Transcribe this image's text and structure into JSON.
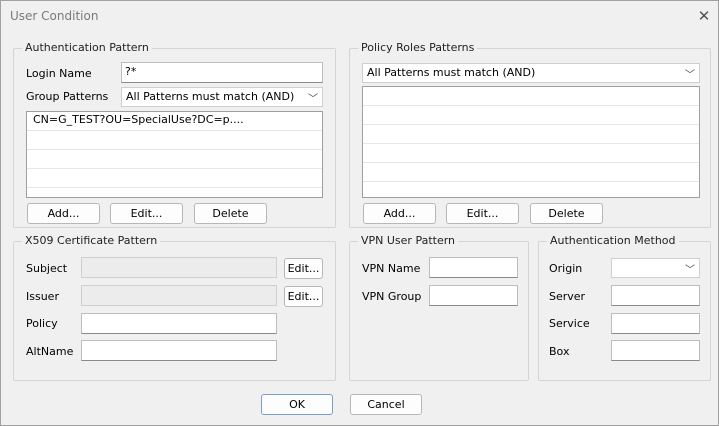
{
  "window": {
    "title": "User Condition"
  },
  "auth_pattern": {
    "legend": "Authentication Pattern",
    "login_label": "Login Name",
    "login_value": "?*",
    "group_label": "Group Patterns",
    "group_select": "All Patterns must match (AND)",
    "items": [
      "CN=G_TEST?OU=SpecialUse?DC=p....",
      "",
      "",
      "",
      ""
    ],
    "add": "Add...",
    "edit": "Edit...",
    "delete": "Delete"
  },
  "policy_roles": {
    "legend": "Policy Roles Patterns",
    "select": "All Patterns must match (AND)",
    "items": [
      "",
      "",
      "",
      "",
      "",
      ""
    ],
    "add": "Add...",
    "edit": "Edit...",
    "delete": "Delete"
  },
  "x509": {
    "legend": "X509 Certificate Pattern",
    "subject_label": "Subject",
    "issuer_label": "Issuer",
    "policy_label": "Policy",
    "altname_label": "AltName",
    "subject_edit": "Edit...",
    "issuer_edit": "Edit..."
  },
  "vpn_user": {
    "legend": "VPN User Pattern",
    "name_label": "VPN Name",
    "group_label": "VPN Group"
  },
  "auth_method": {
    "legend": "Authentication Method",
    "origin_label": "Origin",
    "server_label": "Server",
    "service_label": "Service",
    "box_label": "Box"
  },
  "footer": {
    "ok": "OK",
    "cancel": "Cancel"
  }
}
